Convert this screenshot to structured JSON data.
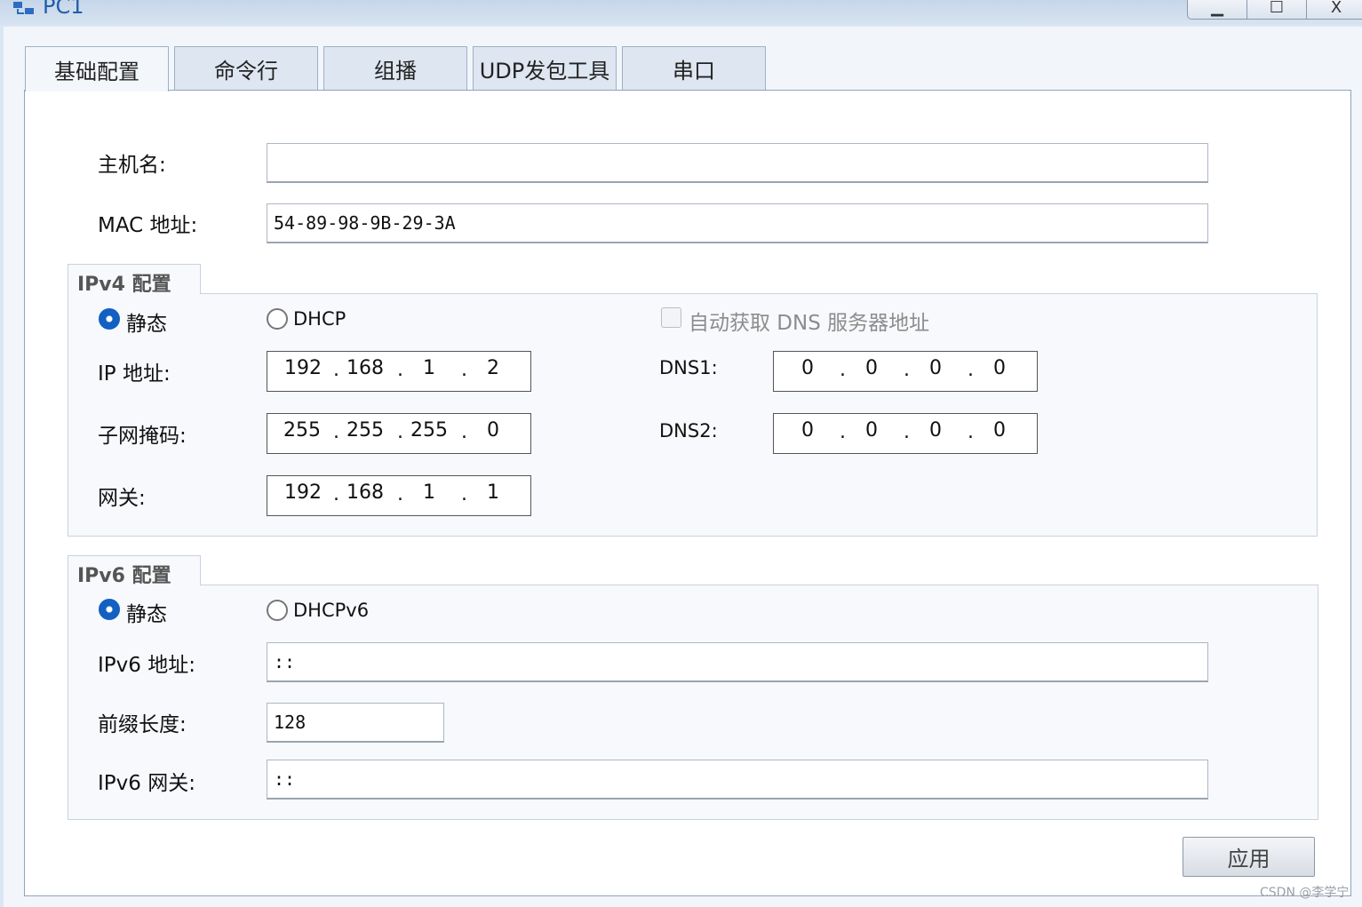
{
  "window": {
    "title": "PC1",
    "minimize": "▁",
    "maximize": "☐",
    "close": "X"
  },
  "tabs": [
    "基础配置",
    "命令行",
    "组播",
    "UDP发包工具",
    "串口"
  ],
  "basic": {
    "hostname_label": "主机名:",
    "hostname_value": "",
    "mac_label": "MAC 地址:",
    "mac_value": "54-89-98-9B-29-3A"
  },
  "ipv4": {
    "title": "IPv4 配置",
    "static_label": "静态",
    "dhcp_label": "DHCP",
    "mode": "static",
    "auto_dns_label": "自动获取 DNS 服务器地址",
    "auto_dns_checked": false,
    "ip_label": "IP 地址:",
    "ip": [
      "192",
      "168",
      "1",
      "2"
    ],
    "mask_label": "子网掩码:",
    "mask": [
      "255",
      "255",
      "255",
      "0"
    ],
    "gateway_label": "网关:",
    "gateway": [
      "192",
      "168",
      "1",
      "1"
    ],
    "dns1_label": "DNS1:",
    "dns1": [
      "0",
      "0",
      "0",
      "0"
    ],
    "dns2_label": "DNS2:",
    "dns2": [
      "0",
      "0",
      "0",
      "0"
    ]
  },
  "ipv6": {
    "title": "IPv6 配置",
    "static_label": "静态",
    "dhcpv6_label": "DHCPv6",
    "mode": "static",
    "addr_label": "IPv6 地址:",
    "addr_value": "::",
    "prefix_label": "前缀长度:",
    "prefix_value": "128",
    "gateway_label": "IPv6 网关:",
    "gateway_value": "::"
  },
  "apply_label": "应用",
  "watermark": "CSDN @李学宁"
}
